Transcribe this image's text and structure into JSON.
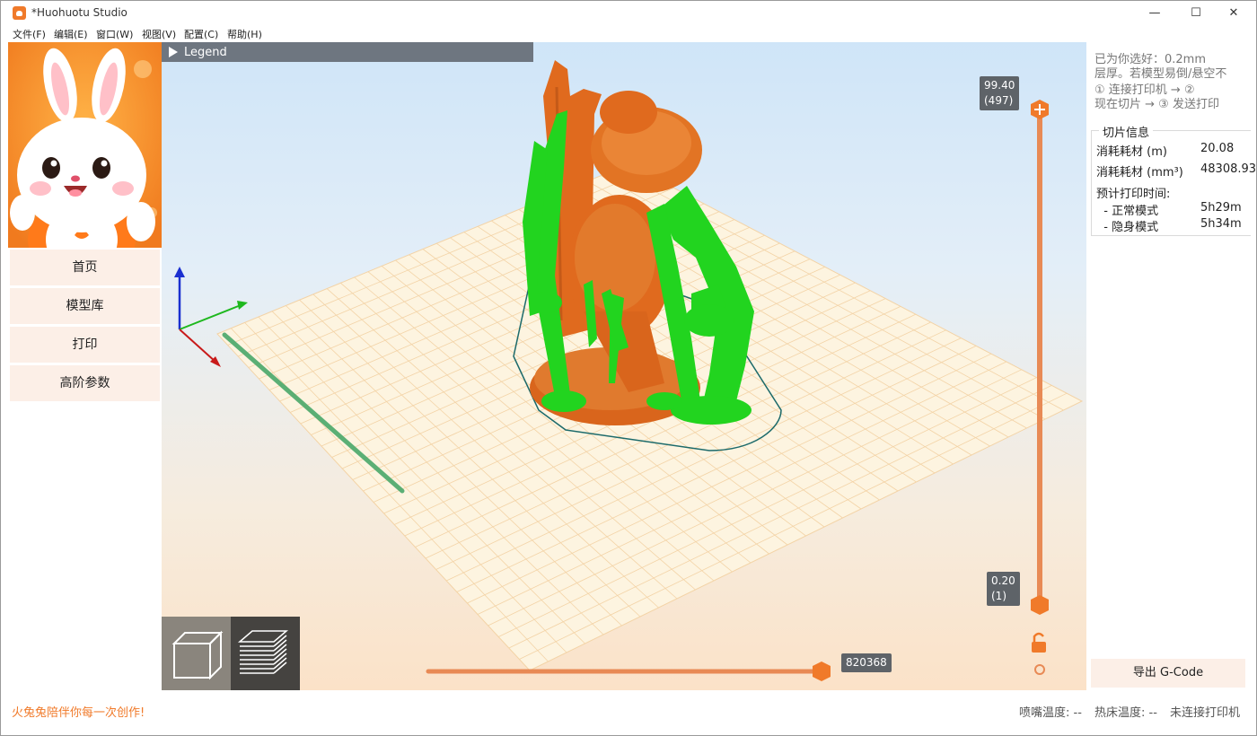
{
  "window": {
    "title": "*Huohuotu Studio",
    "minimize": "—",
    "maximize": "☐",
    "close": "✕"
  },
  "menu": [
    {
      "label": "文件(F)"
    },
    {
      "label": "编辑(E)"
    },
    {
      "label": "窗口(W)"
    },
    {
      "label": "视图(V)"
    },
    {
      "label": "配置(C)"
    },
    {
      "label": "帮助(H)"
    }
  ],
  "sidebar": {
    "items": [
      {
        "label": "首页"
      },
      {
        "label": "模型库"
      },
      {
        "label": "打印"
      },
      {
        "label": "高阶参数"
      }
    ]
  },
  "viewport": {
    "legend_label": "Legend",
    "layer_top": {
      "height": "99.40",
      "layer": "(497)"
    },
    "layer_bottom": {
      "height": "0.20",
      "layer": "(1)"
    },
    "move_value": "820368",
    "view_buttons": [
      {
        "name": "3d-view",
        "icon": "cube-icon"
      },
      {
        "name": "layer-view",
        "icon": "layers-icon"
      }
    ],
    "colors": {
      "model": "#e06a1e",
      "support": "#22d41f",
      "slider": "#e88a55"
    }
  },
  "right_panel": {
    "tip_lines": [
      "已为你选好：0.2mm",
      "层厚。若模型易倒/悬空不",
      "① 连接打印机 → ②",
      "现在切片 → ③ 发送打印"
    ],
    "slice_info": {
      "title": "切片信息",
      "rows": [
        {
          "label": "消耗耗材 (m)",
          "value": "20.08"
        },
        {
          "label": "消耗耗材 (mm³)",
          "value": "48308.93"
        },
        {
          "label": "预计打印时间:",
          "value": ""
        },
        {
          "label": "  - 正常模式",
          "value": "5h29m"
        },
        {
          "label": "  - 隐身模式",
          "value": "5h34m"
        }
      ]
    },
    "export_label": "导出 G-Code"
  },
  "status": {
    "slogan": "火兔兔陪伴你每一次创作!",
    "nozzle_temp": "喷嘴温度: --",
    "bed_temp": "热床温度: --",
    "printer_status": "未连接打印机"
  }
}
